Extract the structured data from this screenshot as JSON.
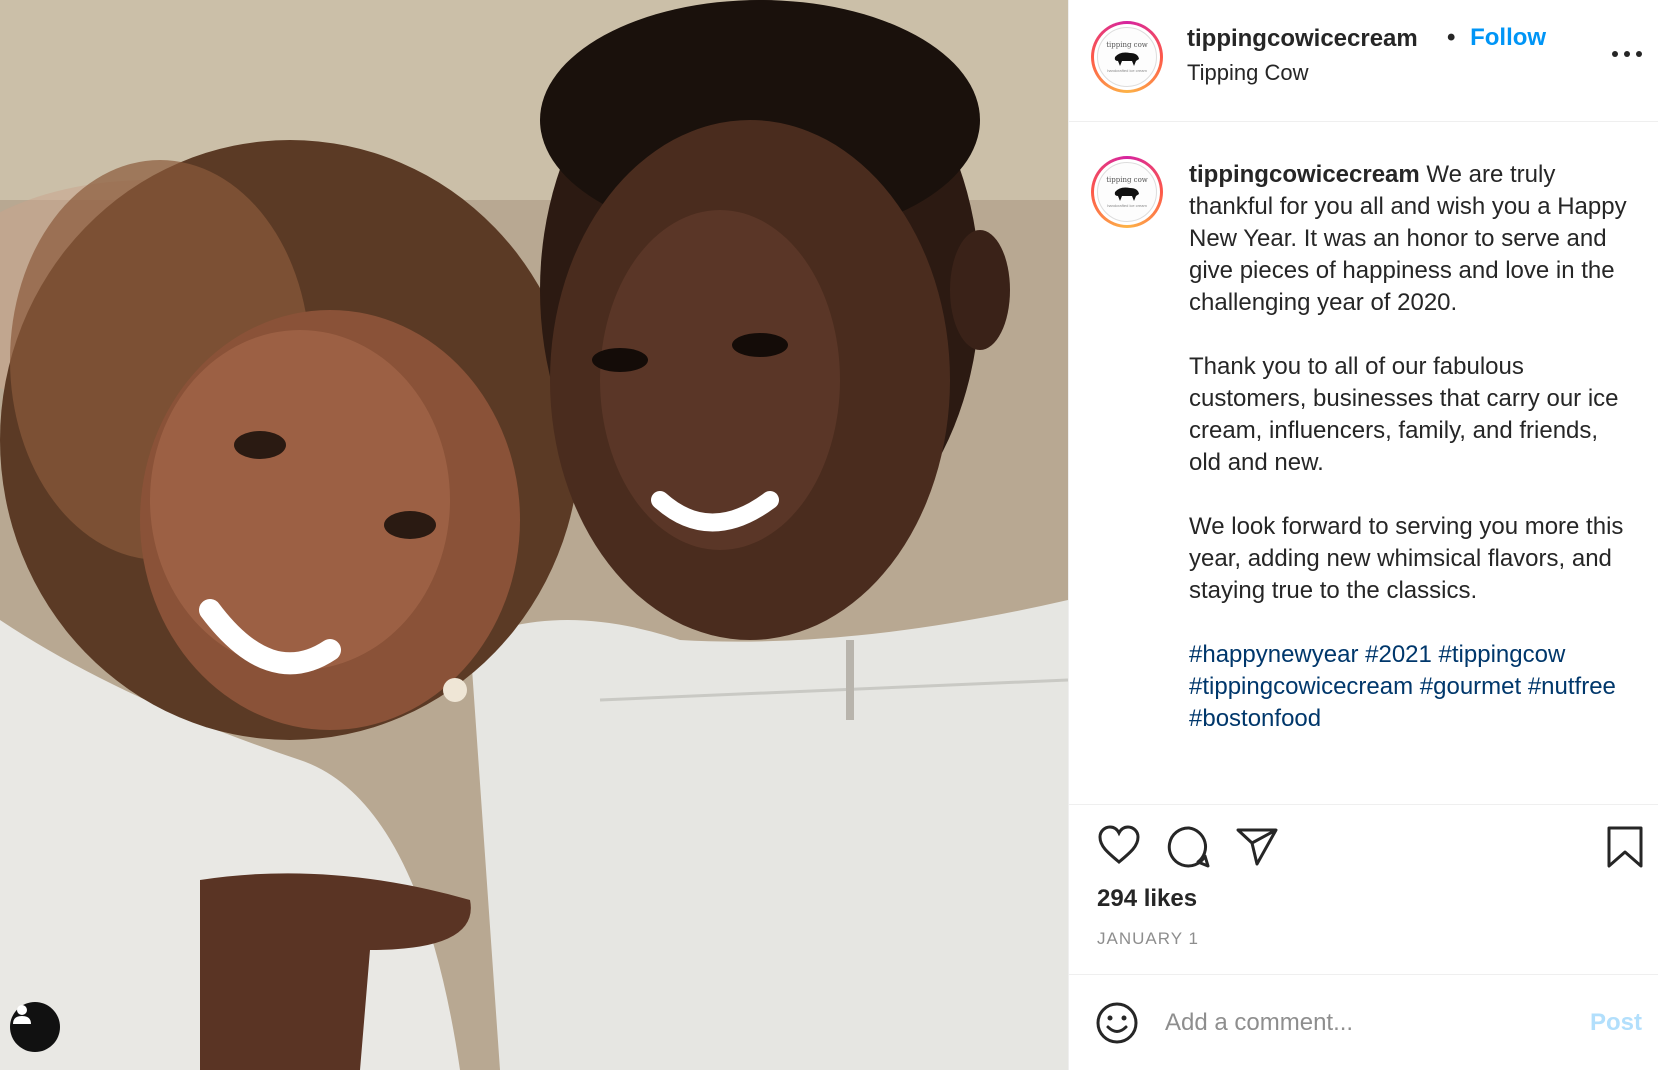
{
  "photo": {
    "alt": "",
    "tag_icon": "user-icon"
  },
  "header": {
    "username": "tippingcowicecream",
    "separator": "•",
    "follow_label": "Follow",
    "location": "Tipping Cow",
    "avatar_text_1": "tipping cow",
    "avatar_text_2": "handcrafted ice cream",
    "more_icon": "more-horizontal-icon"
  },
  "caption": {
    "username": "tippingcowicecream",
    "paragraph_1": "We are truly thankful for you all and wish you a Happy New Year. It was an honor to serve and give pieces of happiness and love in the challenging year of 2020.",
    "paragraph_2": "Thank you to all of our fabulous customers, businesses that carry our ice cream, influencers, family, and friends, old and new.",
    "paragraph_3": "We look forward to serving you more this year, adding new whimsical flavors, and staying true to the classics.",
    "hashtags": "#happynewyear #2021 #tippingcow #tippingcowicecream #gourmet #nutfree #bostonfood"
  },
  "actions": {
    "like_icon": "heart-icon",
    "comment_icon": "comment-icon",
    "share_icon": "paper-plane-icon",
    "save_icon": "bookmark-icon",
    "likes": "294 likes",
    "date": "JANUARY 1"
  },
  "comment": {
    "placeholder": "Add a comment...",
    "post_label": "Post",
    "emoji_icon": "smiley-icon"
  },
  "colors": {
    "link_blue": "#0095f6",
    "hashtag_blue": "#00376b",
    "post_disabled": "#b2dffc",
    "secondary_text": "#8e8e8e"
  }
}
